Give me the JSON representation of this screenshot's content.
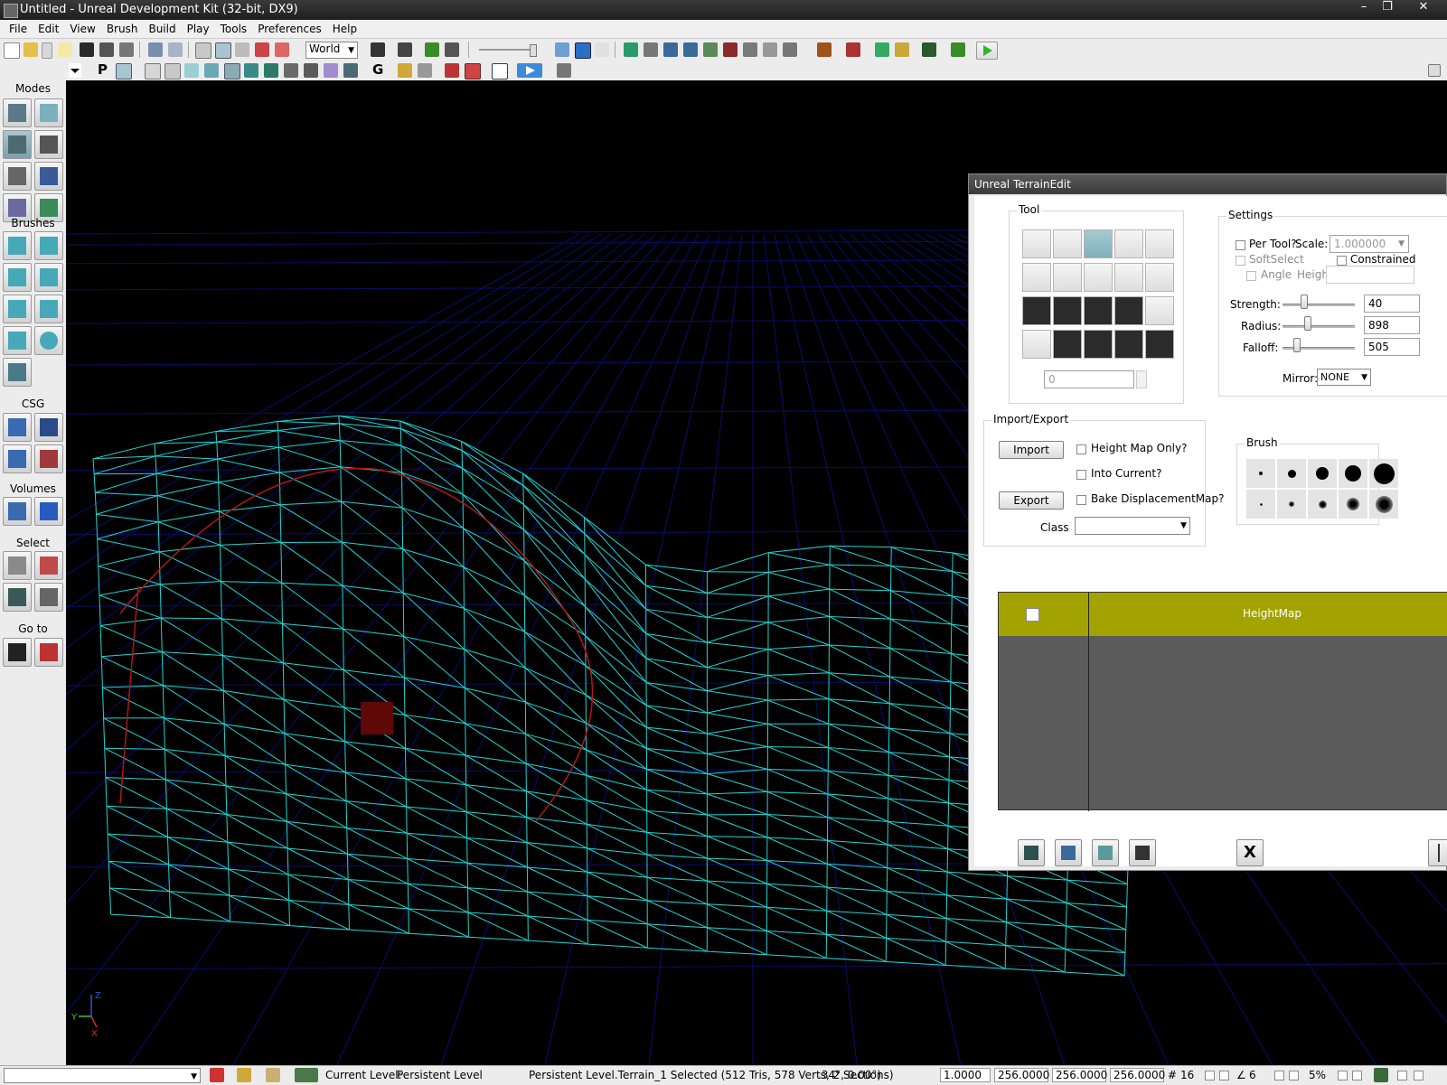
{
  "window": {
    "title": "Untitled - Unreal Development Kit (32-bit, DX9)"
  },
  "menu": [
    "File",
    "Edit",
    "View",
    "Brush",
    "Build",
    "Play",
    "Tools",
    "Preferences",
    "Help"
  ],
  "toolbar": {
    "coord_system": "World"
  },
  "toolbar2": {
    "p_label": "P",
    "g_label": "G"
  },
  "left_panel": {
    "modes_label": "Modes",
    "brushes_label": "Brushes",
    "csg_label": "CSG",
    "volumes_label": "Volumes",
    "select_label": "Select",
    "goto_label": "Go to"
  },
  "terrain_edit": {
    "title": "Unreal TerrainEdit",
    "tool_group_label": "Tool",
    "tool_numeric_value": "0",
    "settings": {
      "label": "Settings",
      "per_tool_label": "Per Tool?",
      "scale_label": "Scale:",
      "scale_value": "1.000000",
      "softselect_label": "SoftSelect",
      "constrained_label": "Constrained",
      "angle_label": "Angle",
      "height_label": "Height",
      "strength_label": "Strength:",
      "strength_value": "40",
      "strength_fraction": 0.3,
      "radius_label": "Radius:",
      "radius_value": "898",
      "radius_fraction": 0.35,
      "falloff_label": "Falloff:",
      "falloff_value": "505",
      "falloff_fraction": 0.2,
      "mirror_label": "Mirror:",
      "mirror_value": "NONE"
    },
    "import_export": {
      "label": "Import/Export",
      "import_button": "Import",
      "export_button": "Export",
      "height_map_only_label": "Height Map Only?",
      "into_current_label": "Into Current?",
      "bake_label": "Bake DisplacementMap?",
      "class_label": "Class"
    },
    "brush_label": "Brush",
    "layer": {
      "name": "HeightMap"
    },
    "close_glyph": "X"
  },
  "status": {
    "current_level_label": "Current Level:",
    "current_level_value": "Persistent Level",
    "selection_text": "Persistent Level.Terrain_1 Selected (512 Tris, 578 Verts, 2 Sections)",
    "coords_text": ".34°, 0.00°)",
    "drag_scale": "1.0000",
    "grid1": "256.0000",
    "grid2": "256.0000",
    "grid3": "256.0000",
    "grid_size": "16",
    "angle_snap": "6",
    "scale_snap": "5%"
  },
  "axis": {
    "z": "Z",
    "y": "Y",
    "x": "X"
  },
  "colors": {
    "wire": "#1ed7d2",
    "red_curve": "#b01818",
    "grid_blue": "#0c0c6e",
    "layer_header": "#a3a300"
  }
}
